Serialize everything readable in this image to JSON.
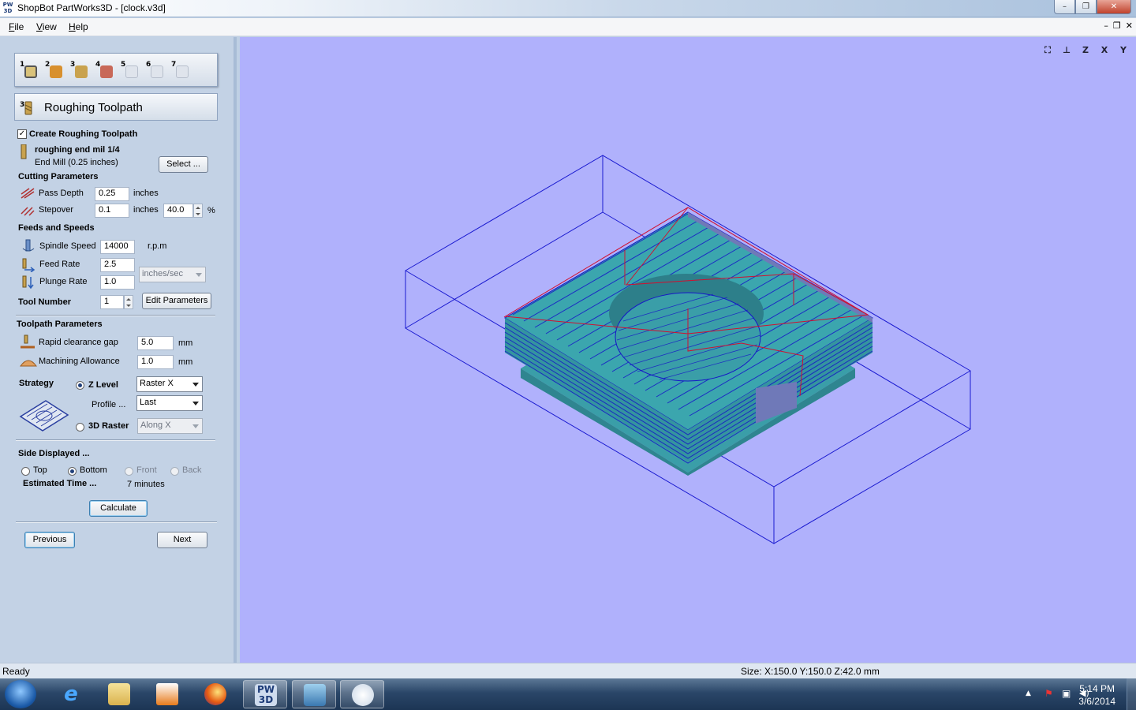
{
  "window": {
    "app_icon_text": "PW 3D",
    "title": "ShopBot PartWorks3D - [clock.v3d]",
    "min": "–",
    "max": "❐",
    "close": "✕"
  },
  "menu": {
    "items": [
      "File",
      "View",
      "Help"
    ],
    "mdi_min": "–",
    "mdi_restore": "❐",
    "mdi_close": "✕"
  },
  "steps": [
    "1",
    "2",
    "3",
    "4",
    "5",
    "6",
    "7"
  ],
  "panel": {
    "header_title": "Roughing Toolpath",
    "create_label": "Create Roughing Toolpath",
    "create_checked": true,
    "tool_name": "roughing end mil 1/4",
    "tool_desc": "End Mill (0.25 inches)",
    "select_button": "Select ...",
    "cutting_params_label": "Cutting Parameters",
    "pass_depth": {
      "label": "Pass Depth",
      "value": "0.25",
      "unit": "inches"
    },
    "stepover": {
      "label": "Stepover",
      "value": "0.1",
      "unit": "inches",
      "percent": "40.0",
      "percent_unit": "%"
    },
    "feeds_label": "Feeds and Speeds",
    "spindle": {
      "label": "Spindle Speed",
      "value": "14000",
      "unit": "r.p.m"
    },
    "feed_rate": {
      "label": "Feed Rate",
      "value": "2.5"
    },
    "plunge_rate": {
      "label": "Plunge Rate",
      "value": "1.0"
    },
    "rate_unit": "inches/sec",
    "tool_number": {
      "label": "Tool Number",
      "value": "1"
    },
    "edit_params_button": "Edit Parameters",
    "toolpath_params_label": "Toolpath Parameters",
    "rapid_gap": {
      "label": "Rapid clearance gap",
      "value": "5.0",
      "unit": "mm"
    },
    "machining_allowance": {
      "label": "Machining Allowance",
      "value": "1.0",
      "unit": "mm"
    },
    "strategy_label": "Strategy",
    "z_level": {
      "label": "Z Level",
      "selected": true,
      "combo": "Raster X"
    },
    "profile": {
      "label": "Profile ...",
      "combo": "Last"
    },
    "raster_3d": {
      "label": "3D Raster",
      "selected": false,
      "combo": "Along X"
    },
    "side_displayed_label": "Side Displayed ...",
    "sides": [
      {
        "label": "Top",
        "selected": false,
        "enabled": true
      },
      {
        "label": "Bottom",
        "selected": true,
        "enabled": true
      },
      {
        "label": "Front",
        "selected": false,
        "enabled": false
      },
      {
        "label": "Back",
        "selected": false,
        "enabled": false
      }
    ],
    "estimated_time_label": "Estimated Time ...",
    "estimated_time_value": "7 minutes",
    "calculate_button": "Calculate",
    "previous_button": "Previous",
    "next_button": "Next"
  },
  "view_icons": [
    "fit-view-icon",
    "iso-view-icon",
    "z-view-icon",
    "x-view-icon",
    "y-view-icon"
  ],
  "view_icon_labels": [
    "⛶",
    "⊥",
    "Z",
    "X",
    "Y"
  ],
  "status": {
    "left": "Ready",
    "size": "Size: X:150.0 Y:150.0 Z:42.0 mm"
  },
  "taskbar": {
    "time": "5:14 PM",
    "date": "3/6/2014",
    "pw_label": "PW 3D",
    "ie_label": "e",
    "tray_up": "▲",
    "tray_flag": "⚑",
    "tray_net": "▣",
    "tray_vol": "◀)"
  },
  "colors": {
    "viewport_bg": "#b0b1fc",
    "model_teal": "#3a9ea8",
    "toolpath_blue": "#1515c8",
    "rapid_red": "#d01030",
    "panel_bg": "#c3d2e5"
  }
}
